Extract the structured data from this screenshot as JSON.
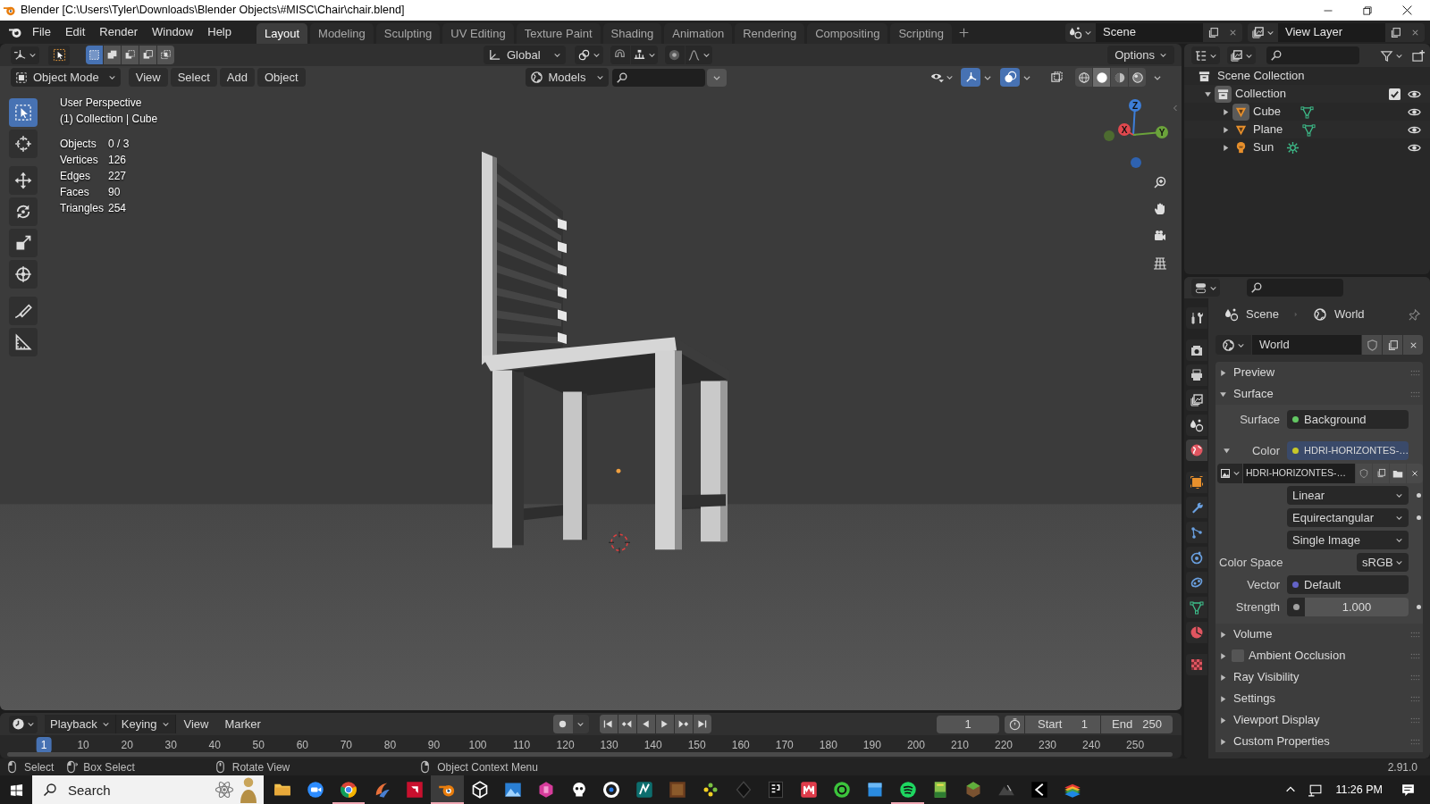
{
  "title_bar": {
    "title": "Blender [C:\\Users\\Tyler\\Downloads\\Blender Objects\\#MISC\\Chair\\chair.blend]"
  },
  "menu": [
    "File",
    "Edit",
    "Render",
    "Window",
    "Help"
  ],
  "workspaces": [
    {
      "label": "Layout",
      "selected": true
    },
    {
      "label": "Modeling",
      "selected": false
    },
    {
      "label": "Sculpting",
      "selected": false
    },
    {
      "label": "UV Editing",
      "selected": false
    },
    {
      "label": "Texture Paint",
      "selected": false
    },
    {
      "label": "Shading",
      "selected": false
    },
    {
      "label": "Animation",
      "selected": false
    },
    {
      "label": "Rendering",
      "selected": false
    },
    {
      "label": "Compositing",
      "selected": false
    },
    {
      "label": "Scripting",
      "selected": false
    }
  ],
  "scene": "Scene",
  "view_layer": "View Layer",
  "viewport": {
    "orientation": "Global",
    "options": "Options",
    "mode": "Object Mode",
    "menus": [
      "View",
      "Select",
      "Add",
      "Object"
    ],
    "collection": "Models",
    "view_name": "User Perspective",
    "context": "(1) Collection | Cube",
    "stats": [
      {
        "label": "Objects",
        "value": "0 / 3"
      },
      {
        "label": "Vertices",
        "value": "126"
      },
      {
        "label": "Edges",
        "value": "227"
      },
      {
        "label": "Faces",
        "value": "90"
      },
      {
        "label": "Triangles",
        "value": "254"
      }
    ],
    "select_modes": [
      {
        "kind": "set",
        "selected": true
      },
      {
        "kind": "extend",
        "selected": false
      },
      {
        "kind": "subtract",
        "selected": false
      },
      {
        "kind": "difference",
        "selected": false
      },
      {
        "kind": "intersect",
        "selected": false
      }
    ],
    "tools": [
      {
        "kind": "select",
        "selected": true
      },
      {
        "kind": "cursor",
        "selected": false
      },
      {
        "kind": "move",
        "selected": false
      },
      {
        "kind": "rotate",
        "selected": false
      },
      {
        "kind": "scale",
        "selected": false
      },
      {
        "kind": "transform",
        "selected": false
      },
      {
        "kind": "annotate",
        "selected": false
      },
      {
        "kind": "measure",
        "selected": false
      }
    ],
    "shading": [
      {
        "kind": "wireframe",
        "selected": false
      },
      {
        "kind": "solid",
        "selected": true
      },
      {
        "kind": "material",
        "selected": false
      },
      {
        "kind": "rendered",
        "selected": false
      }
    ],
    "gizmo": [
      {
        "kind": "z",
        "label": "Z"
      },
      {
        "kind": "x",
        "label": "X"
      },
      {
        "kind": "y",
        "label": "Y"
      }
    ]
  },
  "outliner": {
    "root": "Scene Collection",
    "tree": [
      {
        "label": "Collection",
        "kind": "collection",
        "expanded": true,
        "selected": true,
        "checked": true,
        "children": [
          {
            "label": "Cube",
            "kind": "mesh",
            "expanded": false,
            "selected": true
          },
          {
            "label": "Plane",
            "kind": "mesh",
            "expanded": false,
            "selected": false
          },
          {
            "label": "Sun",
            "kind": "light",
            "expanded": false,
            "selected": false
          }
        ]
      }
    ]
  },
  "properties": {
    "tabs": [
      {
        "kind": "tool",
        "selected": false
      },
      {
        "kind": "render",
        "selected": false
      },
      {
        "kind": "output",
        "selected": false
      },
      {
        "kind": "view_layer",
        "selected": false
      },
      {
        "kind": "scene",
        "selected": false
      },
      {
        "kind": "world",
        "selected": true
      },
      {
        "kind": "object",
        "selected": false
      },
      {
        "kind": "modifiers",
        "selected": false
      },
      {
        "kind": "particles",
        "selected": false
      },
      {
        "kind": "physics",
        "selected": false
      },
      {
        "kind": "constraints",
        "selected": false
      },
      {
        "kind": "data",
        "selected": false
      },
      {
        "kind": "material",
        "selected": false
      },
      {
        "kind": "texture",
        "selected": false
      }
    ],
    "breadcrumb": [
      {
        "kind": "scene",
        "label": "Scene"
      },
      {
        "kind": "world",
        "label": "World"
      }
    ],
    "world_name": "World",
    "panels": [
      {
        "label": "Preview",
        "expanded": false
      },
      {
        "label": "Surface",
        "expanded": true,
        "fields": [
          {
            "kind": "socket",
            "label": "Surface",
            "value": "Background",
            "color": "#63c763"
          },
          {
            "kind": "linked_socket",
            "label": "Color",
            "value": "HDRI-HORIZONTES-…",
            "color": "#c7c729",
            "expanded": true,
            "highlighted": true
          },
          {
            "kind": "image",
            "value": "HDRI-HORIZONTES-…"
          },
          {
            "kind": "dropdown",
            "value": "Linear",
            "animatable": true
          },
          {
            "kind": "dropdown",
            "value": "Equirectangular",
            "animatable": true
          },
          {
            "kind": "dropdown",
            "value": "Single Image",
            "animatable": false
          },
          {
            "kind": "dropdown",
            "label": "Color Space",
            "value": "sRGB",
            "animatable": false
          },
          {
            "kind": "socket",
            "label": "Vector",
            "value": "Default",
            "color": "#6363c7"
          },
          {
            "kind": "slider",
            "label": "Strength",
            "value": "1.000",
            "color": "#a1a1a1",
            "animatable": true
          }
        ]
      },
      {
        "label": "Volume",
        "expanded": false
      },
      {
        "label": "Ambient Occlusion",
        "expanded": false,
        "checked": false
      },
      {
        "label": "Ray Visibility",
        "expanded": false
      },
      {
        "label": "Settings",
        "expanded": false
      },
      {
        "label": "Viewport Display",
        "expanded": false
      },
      {
        "label": "Custom Properties",
        "expanded": false
      }
    ]
  },
  "timeline": {
    "menus": [
      {
        "kind": "dropdown",
        "label": "Playback"
      },
      {
        "kind": "dropdown",
        "label": "Keying"
      },
      {
        "kind": "menu",
        "label": "View"
      },
      {
        "kind": "menu",
        "label": "Marker"
      }
    ],
    "current_frame": "1",
    "start_label": "Start",
    "start": "1",
    "end_label": "End",
    "end": "250",
    "ruler": [
      {
        "label": "1",
        "selected": true
      },
      {
        "label": "10",
        "selected": false
      },
      {
        "label": "20",
        "selected": false
      },
      {
        "label": "30",
        "selected": false
      },
      {
        "label": "40",
        "selected": false
      },
      {
        "label": "50",
        "selected": false
      },
      {
        "label": "60",
        "selected": false
      },
      {
        "label": "70",
        "selected": false
      },
      {
        "label": "80",
        "selected": false
      },
      {
        "label": "90",
        "selected": false
      },
      {
        "label": "100",
        "selected": false
      },
      {
        "label": "110",
        "selected": false
      },
      {
        "label": "120",
        "selected": false
      },
      {
        "label": "130",
        "selected": false
      },
      {
        "label": "140",
        "selected": false
      },
      {
        "label": "150",
        "selected": false
      },
      {
        "label": "160",
        "selected": false
      },
      {
        "label": "170",
        "selected": false
      },
      {
        "label": "180",
        "selected": false
      },
      {
        "label": "190",
        "selected": false
      },
      {
        "label": "200",
        "selected": false
      },
      {
        "label": "210",
        "selected": false
      },
      {
        "label": "220",
        "selected": false
      },
      {
        "label": "230",
        "selected": false
      },
      {
        "label": "240",
        "selected": false
      },
      {
        "label": "250",
        "selected": false
      }
    ]
  },
  "status_bar": {
    "hints": [
      {
        "kind": "left",
        "label": "Select"
      },
      {
        "kind": "left_drag",
        "label": "Box Select"
      },
      {
        "kind": "middle",
        "label": "Rotate View"
      },
      {
        "kind": "right",
        "label": "Object Context Menu"
      }
    ],
    "version": "2.91.0"
  },
  "taskbar": {
    "search_placeholder": "Search",
    "time": "11:26 PM",
    "apps": [
      {
        "running": false,
        "focused": false
      },
      {
        "running": false,
        "focused": false
      },
      {
        "running": true,
        "focused": false
      },
      {
        "running": false,
        "focused": false
      },
      {
        "running": false,
        "focused": false
      },
      {
        "running": true,
        "focused": true
      },
      {
        "running": false,
        "focused": false
      },
      {
        "running": false,
        "focused": false
      },
      {
        "running": false,
        "focused": false
      },
      {
        "running": false,
        "focused": false
      },
      {
        "running": false,
        "focused": false
      },
      {
        "running": false,
        "focused": false
      },
      {
        "running": false,
        "focused": false
      },
      {
        "running": false,
        "focused": false
      },
      {
        "running": false,
        "focused": false
      },
      {
        "running": false,
        "focused": false
      },
      {
        "running": false,
        "focused": false
      },
      {
        "running": false,
        "focused": false
      },
      {
        "running": false,
        "focused": false
      },
      {
        "running": true,
        "focused": false
      },
      {
        "running": false,
        "focused": false
      },
      {
        "running": false,
        "focused": false
      },
      {
        "running": false,
        "focused": false
      },
      {
        "running": false,
        "focused": false
      },
      {
        "running": false,
        "focused": false
      }
    ]
  }
}
